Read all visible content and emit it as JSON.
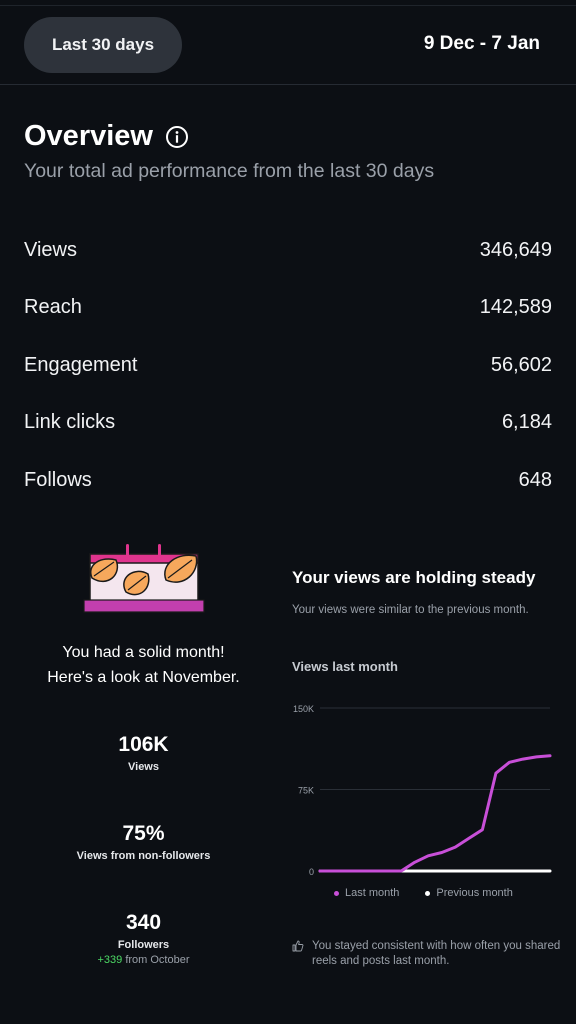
{
  "header": {
    "range_button": "Last 30 days",
    "date_range": "9 Dec - 7 Jan"
  },
  "overview": {
    "title": "Overview",
    "subtitle": "Your total ad performance from the last 30 days",
    "metrics": [
      {
        "label": "Views",
        "value": "346,649"
      },
      {
        "label": "Reach",
        "value": "142,589"
      },
      {
        "label": "Engagement",
        "value": "56,602"
      },
      {
        "label": "Link clicks",
        "value": "6,184"
      },
      {
        "label": "Follows",
        "value": "648"
      }
    ]
  },
  "monthly": {
    "headline": "You had a solid month!\nHere's a look at November.",
    "stats": [
      {
        "value": "106K",
        "label": "Views"
      },
      {
        "value": "75%",
        "label": "Views from non-followers"
      },
      {
        "value": "340",
        "label": "Followers",
        "delta": "+339",
        "delta_suffix": " from October"
      }
    ]
  },
  "views_card": {
    "title": "Your views are holding steady",
    "subtitle": "Your views were similar to the previous month.",
    "chart_heading": "Views last month",
    "legend_last": "Last month",
    "legend_previous": "Previous month",
    "note": "You stayed consistent with how often you shared reels and posts last month."
  },
  "colors": {
    "accent": "#c84fd8",
    "previous": "#ffffff",
    "positive": "#4cd964",
    "background": "#0c0f14"
  },
  "chart_data": {
    "type": "line",
    "ylim": [
      0,
      150000
    ],
    "yticks": [
      "0",
      "75K",
      "150K"
    ],
    "grid": true,
    "legend": "bottom",
    "series": [
      {
        "name": "Last month",
        "color": "#c84fd8",
        "values": [
          0,
          0,
          0,
          0,
          0,
          0,
          0,
          8000,
          14000,
          17000,
          22000,
          30000,
          38000,
          90000,
          100000,
          103000,
          105000,
          106000
        ]
      },
      {
        "name": "Previous month",
        "color": "#ffffff",
        "values": [
          0,
          0,
          0,
          0,
          0,
          0,
          0,
          0,
          0,
          0,
          0,
          0,
          0,
          0,
          0,
          0,
          0,
          0
        ]
      }
    ]
  }
}
